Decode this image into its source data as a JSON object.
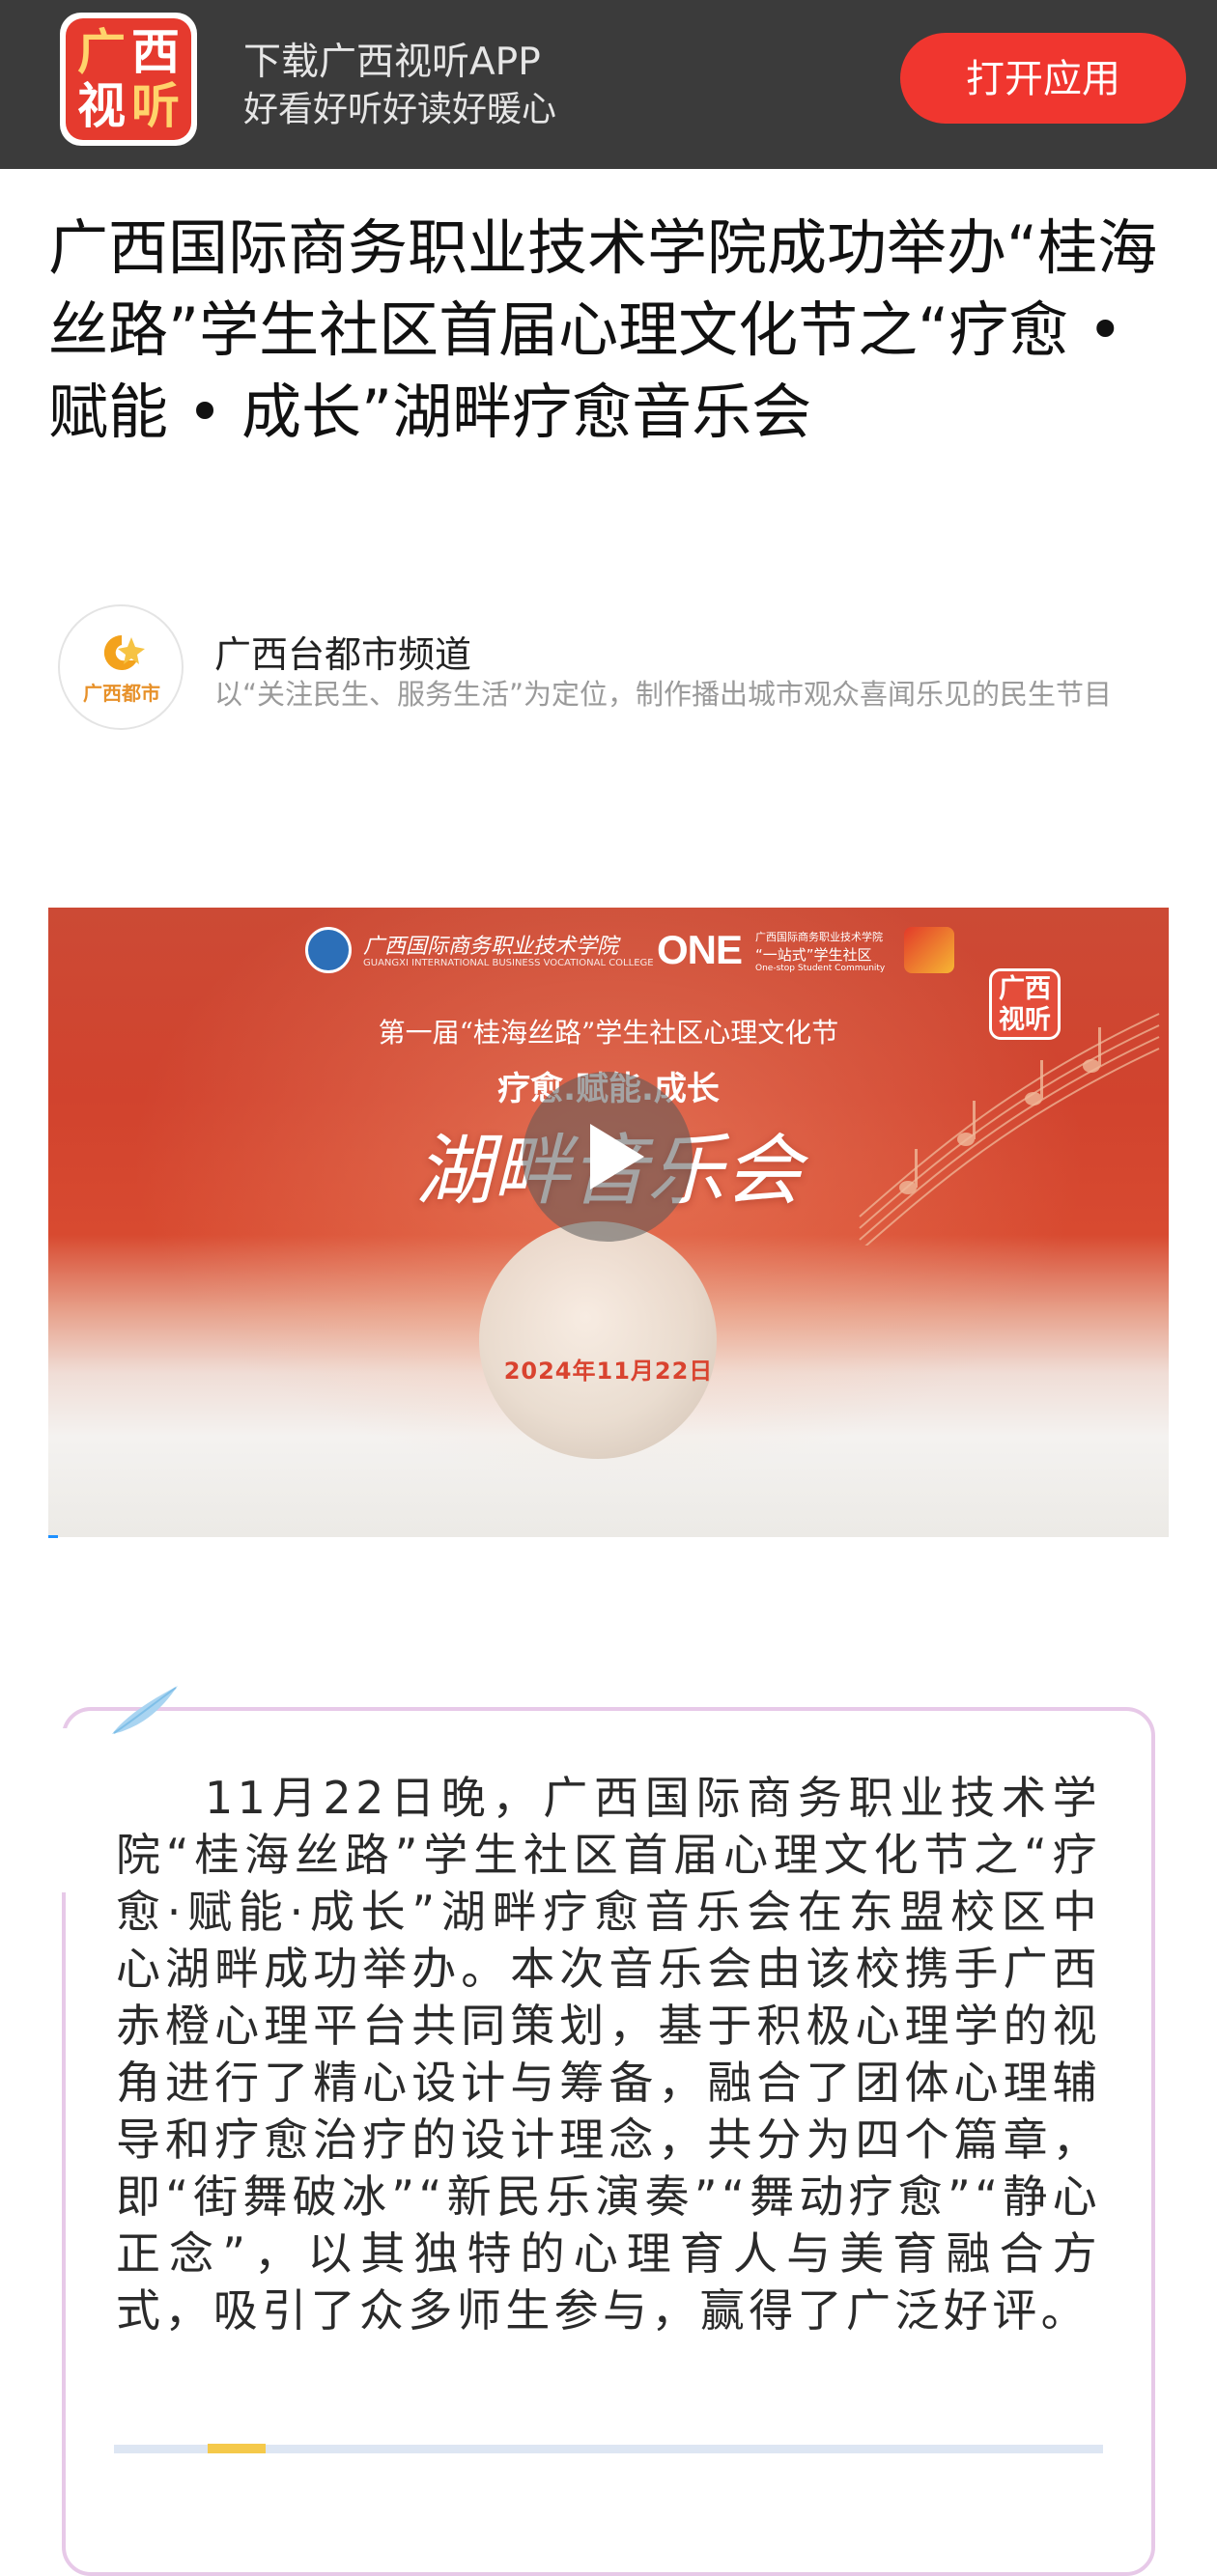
{
  "app_banner": {
    "logo_chars": [
      "广",
      "西",
      "视",
      "听"
    ],
    "title": "下载广西视听APP",
    "subtitle": "好看好听好读好暖心",
    "open_button": "打开应用"
  },
  "article": {
    "headline": "广西国际商务职业技术学院成功举办“桂海丝路”学生社区首届心理文化节之“疗愈 • 赋能 • 成长”湖畔疗愈音乐会",
    "author": {
      "avatar_text": "广西都市",
      "name": "广西台都市频道",
      "description": "以“关注民生、服务生活”为定位，制作播出城市观众喜闻乐见的民生节目"
    },
    "video": {
      "school_name": "广西国际商务职业技术学院",
      "school_name_en": "GUANGXI INTERNATIONAL BUSINESS VOCATIONAL COLLEGE",
      "one_logo": "ONE",
      "one_line1": "广西国际商务职业技术学院",
      "one_line2": "“一站式”学生社区",
      "one_line3": "One-stop Student Community",
      "watermark_chars": [
        "广西",
        "视听"
      ],
      "festival": "第一届“桂海丝路”学生社区心理文化节",
      "theme": "疗愈.赋能.成长",
      "title": "湖畔音乐会",
      "date": "2024年11月22日"
    },
    "body": "11月22日晚，广西国际商务职业技术学院“桂海丝路”学生社区首届心理文化节之“疗愈·赋能·成长”湖畔疗愈音乐会在东盟校区中心湖畔成功举办。本次音乐会由该校携手广西赤橙心理平台共同策划，基于积极心理学的视角进行了精心设计与筹备，融合了团体心理辅导和疗愈治疗的设计理念，共分为四个篇章，即“街舞破冰”“新民乐演奏”“舞动疗愈”“静心正念”，以其独特的心理育人与美育融合方式，吸引了众多师生参与，赢得了广泛好评。"
  },
  "colors": {
    "banner_bg": "#3b3b3b",
    "accent_red": "#f0362f",
    "card_border": "#e7c9e8",
    "video_red": "#d1432e"
  },
  "icons": [
    "app-logo-icon",
    "author-avatar-icon",
    "play-icon",
    "feather-icon",
    "music-notes-icon"
  ]
}
